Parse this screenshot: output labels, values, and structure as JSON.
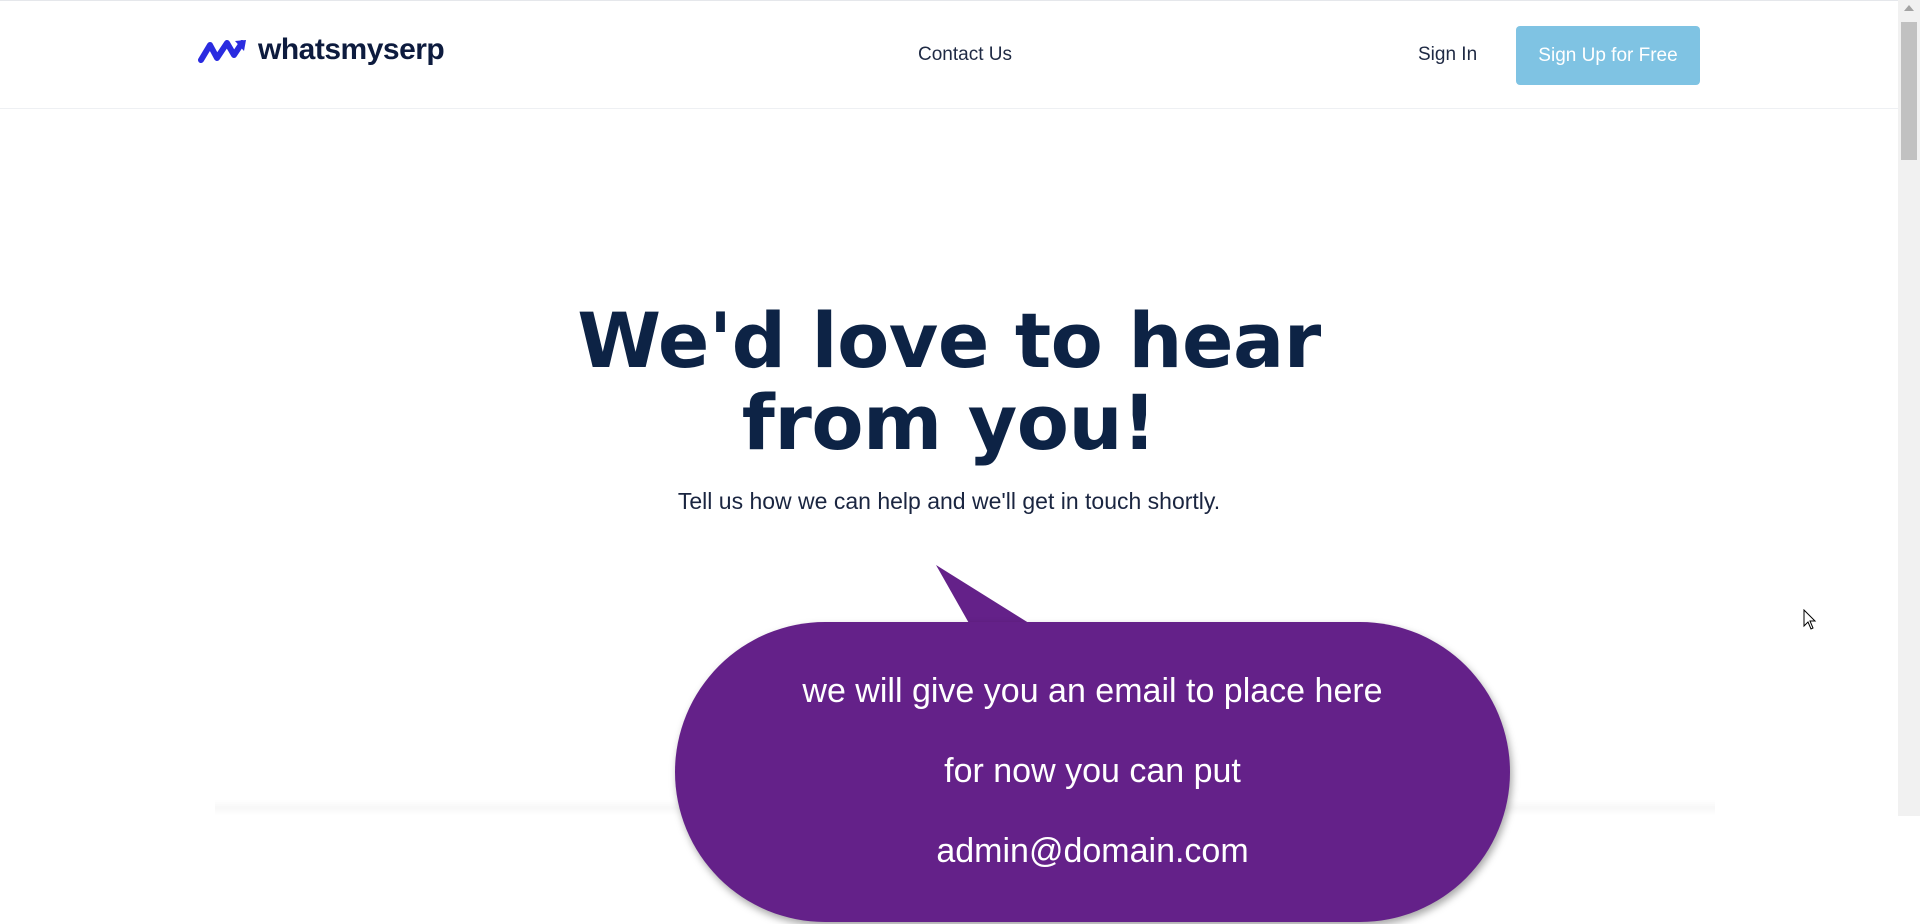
{
  "header": {
    "logo_text": "whatsmyserp",
    "nav": {
      "contact_label": "Contact Us",
      "signin_label": "Sign In",
      "signup_label": "Sign Up for Free"
    }
  },
  "hero": {
    "title_line1": "We'd love to hear",
    "title_line2": "from you!",
    "subtitle": "Tell us how we can help and we'll get in touch shortly."
  },
  "callout": {
    "line1": "we will give you an email to place here",
    "line2": "for now you can put",
    "line3": "admin@domain.com"
  },
  "colors": {
    "brand_navy": "#0d2345",
    "logo_blue": "#2a2be0",
    "signup_button": "#7fc3e3",
    "callout_purple": "#642189"
  }
}
